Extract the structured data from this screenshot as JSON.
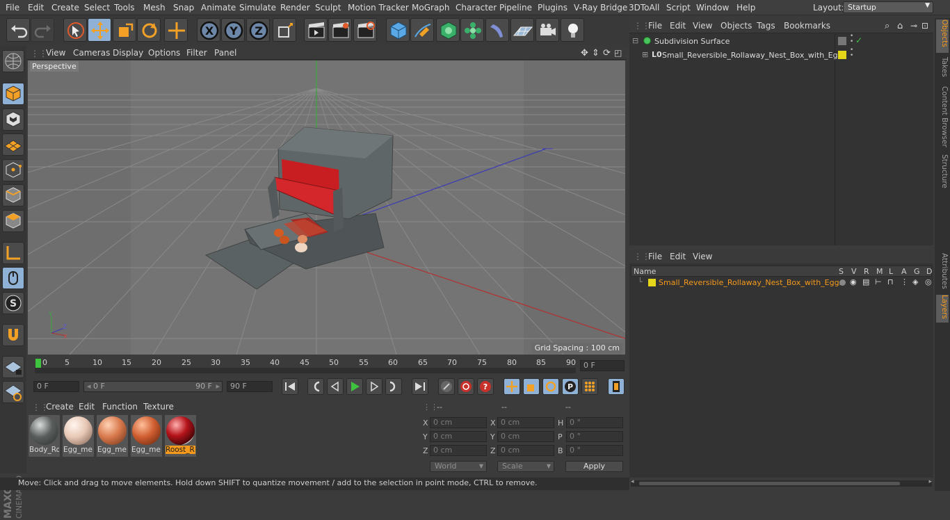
{
  "menubar": {
    "items": [
      "File",
      "Edit",
      "Create",
      "Select",
      "Tools",
      "Mesh",
      "Snap",
      "Animate",
      "Simulate",
      "Render",
      "Sculpt",
      "Motion Tracker",
      "MoGraph",
      "Character",
      "Pipeline",
      "Plugins",
      "V-Ray Bridge",
      "3DToAll",
      "Script",
      "Window",
      "Help"
    ],
    "layout_label": "Layout:",
    "layout_value": "Startup"
  },
  "viewport": {
    "menu": [
      "View",
      "Cameras",
      "Display",
      "Options",
      "Filter",
      "Panel"
    ],
    "label": "Perspective",
    "grid_spacing": "Grid Spacing : 100 cm"
  },
  "timeline": {
    "ticks": [
      "0",
      "5",
      "10",
      "15",
      "20",
      "25",
      "30",
      "35",
      "40",
      "45",
      "50",
      "55",
      "60",
      "65",
      "70",
      "75",
      "80",
      "85",
      "90"
    ],
    "current_frame": "0 F",
    "start_field": "0 F",
    "range_start": "0 F",
    "range_end": "90 F",
    "end_field": "90 F"
  },
  "materials": {
    "menu": [
      "Create",
      "Edit",
      "Function",
      "Texture"
    ],
    "items": [
      {
        "name": "Body_Ro",
        "color": "#5a5f5e"
      },
      {
        "name": "Egg_me",
        "color": "#e8c8b6"
      },
      {
        "name": "Egg_me",
        "color": "#d97a4e"
      },
      {
        "name": "Egg_me",
        "color": "#cf5d30"
      },
      {
        "name": "Roost_R",
        "color": "#b5141a"
      }
    ]
  },
  "coords": {
    "headers": [
      "--",
      "--",
      "--"
    ],
    "rows": [
      {
        "a": "X",
        "av": "0 cm",
        "b": "X",
        "bv": "0 cm",
        "c": "H",
        "cv": "0 °"
      },
      {
        "a": "Y",
        "av": "0 cm",
        "b": "Y",
        "bv": "0 cm",
        "c": "P",
        "cv": "0 °"
      },
      {
        "a": "Z",
        "av": "0 cm",
        "b": "Z",
        "bv": "0 cm",
        "c": "B",
        "cv": "0 °"
      }
    ],
    "space": "World",
    "mode": "Scale",
    "apply": "Apply"
  },
  "status": "Move: Click and drag to move elements. Hold down SHIFT to quantize movement / add to the selection in point mode, CTRL to remove.",
  "objects": {
    "menu": [
      "File",
      "Edit",
      "View",
      "Objects",
      "Tags",
      "Bookmarks"
    ],
    "items": [
      {
        "name": "Subdivision Surface"
      },
      {
        "name": "Small_Reversible_Rollaway_Nest_Box_with_Eggs"
      }
    ]
  },
  "layers": {
    "menu": [
      "File",
      "Edit",
      "View"
    ],
    "columns": [
      "Name",
      "S",
      "V",
      "R",
      "M",
      "L",
      "A",
      "G",
      "D"
    ],
    "items": [
      {
        "name": "Small_Reversible_Rollaway_Nest_Box_with_Eggs"
      }
    ]
  },
  "sidetabs": [
    "Objects",
    "Takes",
    "Content Browser",
    "Structure",
    "Attributes",
    "Layers"
  ],
  "colors": {
    "accent": "#f59a1c",
    "selection_blue": "#8fb1d6",
    "layer_yellow": "#e6d619"
  }
}
